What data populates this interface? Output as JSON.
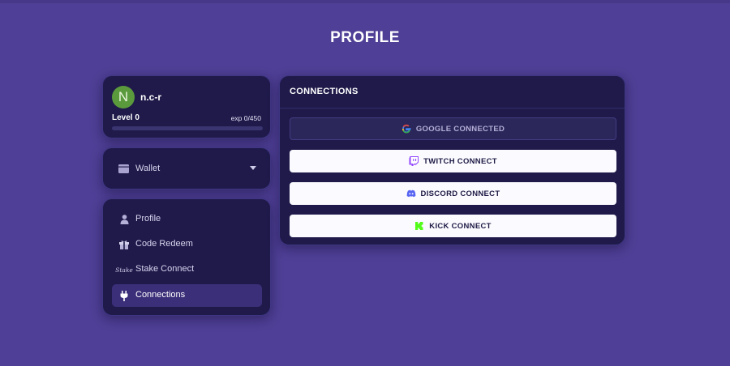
{
  "page": {
    "title": "PROFILE"
  },
  "user": {
    "avatar_initial": "N",
    "avatar_color": "#5b9a3c",
    "name": "n.c-r",
    "level_label": "Level 0",
    "exp_label": "exp 0/450",
    "exp_progress": 0
  },
  "wallet": {
    "label": "Wallet",
    "icon": "wallet-icon"
  },
  "nav": {
    "items": [
      {
        "label": "Profile",
        "icon": "user-icon",
        "active": false
      },
      {
        "label": "Code Redeem",
        "icon": "gift-icon",
        "active": false
      },
      {
        "label": "Stake Connect",
        "icon": "stake-logo-icon",
        "icon_text": "Stake",
        "active": false
      },
      {
        "label": "Connections",
        "icon": "plug-icon",
        "active": true
      }
    ]
  },
  "connections": {
    "title": "CONNECTIONS",
    "buttons": [
      {
        "label": "GOOGLE CONNECTED",
        "icon": "google-icon",
        "state": "connected"
      },
      {
        "label": "TWITCH CONNECT",
        "icon": "twitch-icon",
        "state": "connect"
      },
      {
        "label": "DISCORD CONNECT",
        "icon": "discord-icon",
        "state": "connect"
      },
      {
        "label": "KICK CONNECT",
        "icon": "kick-icon",
        "state": "connect"
      }
    ]
  },
  "colors": {
    "background": "#4f3f96",
    "card": "#1f1a4a",
    "active_nav": "#3a2f78",
    "twitch": "#9146ff",
    "discord": "#5865f2",
    "kick": "#53fc18"
  }
}
